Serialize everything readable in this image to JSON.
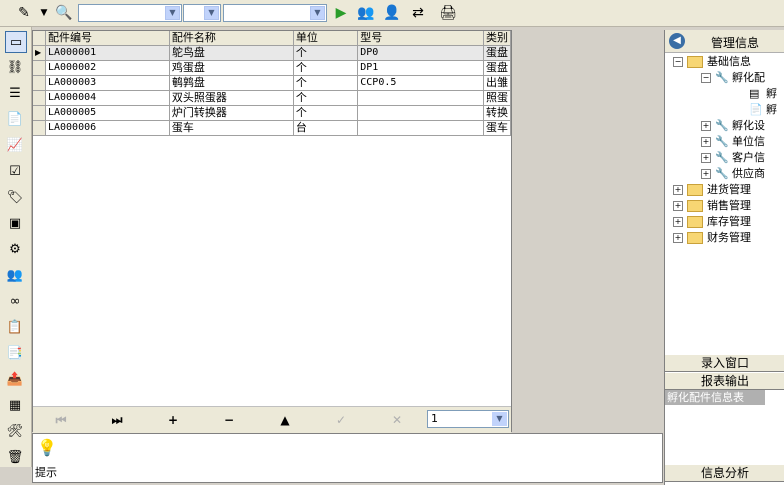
{
  "toolbar": {
    "icons": [
      "pencil-icon",
      "search-icon",
      "play-icon",
      "user-search-icon",
      "user-find-icon",
      "refresh-icon",
      "printer-icon"
    ],
    "combo1": "",
    "combo2": "",
    "combo3": ""
  },
  "leftbar": {
    "icons": [
      "window-icon",
      "network-icon",
      "list-icon",
      "document-icon",
      "chart-icon",
      "checklist-icon",
      "tag-icon",
      "layers-icon",
      "settings-icon",
      "users-icon",
      "link-icon",
      "report-icon",
      "doc-search-icon",
      "export-icon",
      "grid-icon",
      "user-settings-icon",
      "trash-icon"
    ]
  },
  "grid": {
    "columns": [
      "配件编号",
      "配件名称",
      "单位",
      "型号",
      "类别"
    ],
    "rows": [
      [
        "LA000001",
        "鸵鸟盘",
        "个",
        "DP0",
        "蛋盘"
      ],
      [
        "LA000002",
        "鸡蛋盘",
        "个",
        "DP1",
        "蛋盘"
      ],
      [
        "LA000003",
        "鹌鹑盘",
        "个",
        "CCP0.5",
        "出雏"
      ],
      [
        "LA000004",
        "双头照蛋器",
        "个",
        "",
        "照蛋"
      ],
      [
        "LA000005",
        "炉门转换器",
        "个",
        "",
        "转换"
      ],
      [
        "LA000006",
        "蛋车",
        "台",
        "",
        "蛋车"
      ]
    ]
  },
  "nav": {
    "page": "1",
    "buttons": [
      "first",
      "last",
      "add",
      "remove",
      "up",
      "confirm",
      "cancel"
    ]
  },
  "hint": {
    "label": "提示"
  },
  "rightpanel": {
    "title": "管理信息",
    "tree": [
      {
        "label": "基础信息",
        "level": 0
      },
      {
        "label": "孵化配",
        "level": 1
      },
      {
        "label": "孵",
        "level": 2
      },
      {
        "label": "孵",
        "level": 2
      },
      {
        "label": "孵化设",
        "level": 1
      },
      {
        "label": "单位信",
        "level": 1
      },
      {
        "label": "客户信",
        "level": 1
      },
      {
        "label": "供应商",
        "level": 1
      },
      {
        "label": "进货管理",
        "level": 0
      },
      {
        "label": "销售管理",
        "level": 0
      },
      {
        "label": "库存管理",
        "level": 0
      },
      {
        "label": "财务管理",
        "level": 0
      }
    ],
    "btn_entry": "录入窗口",
    "btn_report": "报表输出",
    "selected_item": "孵化配件信息表",
    "btn_analysis": "信息分析"
  }
}
